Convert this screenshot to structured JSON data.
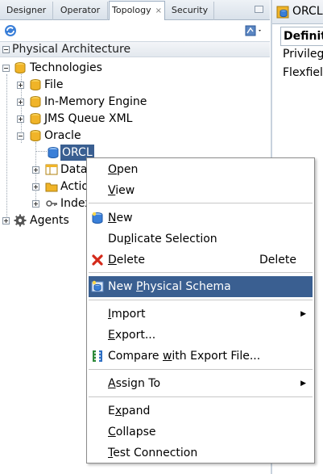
{
  "tabs": [
    {
      "label": "Designer"
    },
    {
      "label": "Operator"
    },
    {
      "label": "Topology",
      "close": "×"
    },
    {
      "label": "Security"
    }
  ],
  "section": {
    "title": "Physical Architecture"
  },
  "tree": {
    "technologies": "Technologies",
    "file": "File",
    "in_memory": "In-Memory Engine",
    "jms": "JMS Queue XML",
    "oracle": "Oracle",
    "orcl": "ORCL",
    "data": "Data",
    "actions": "Actio",
    "indexes": "Index",
    "agents": "Agents"
  },
  "right_pane": {
    "title": "ORCL",
    "subtab": "Definiti",
    "fields": [
      "Privilege",
      "Flexfield"
    ]
  },
  "menu": {
    "open": {
      "pre": "",
      "u": "O",
      "post": "pen"
    },
    "view": {
      "pre": "",
      "u": "V",
      "post": "iew"
    },
    "new": {
      "pre": "",
      "u": "N",
      "post": "ew"
    },
    "duplicate": {
      "pre": "Du",
      "u": "p",
      "post": "licate Selection"
    },
    "delete": {
      "pre": "",
      "u": "D",
      "post": "elete",
      "shortcut": "Delete"
    },
    "new_schema": {
      "pre": "New ",
      "u": "P",
      "post": "hysical Schema"
    },
    "import": {
      "pre": "",
      "u": "I",
      "post": "mport"
    },
    "export": {
      "pre": "",
      "u": "E",
      "post": "xport..."
    },
    "compare": {
      "pre": "Compare ",
      "u": "w",
      "post": "ith Export File..."
    },
    "assign": {
      "pre": "",
      "u": "A",
      "post": "ssign To"
    },
    "expand": {
      "pre": "E",
      "u": "x",
      "post": "pand"
    },
    "collapse": {
      "pre": "",
      "u": "C",
      "post": "ollapse"
    },
    "test": {
      "pre": "",
      "u": "T",
      "post": "est Connection"
    }
  },
  "colors": {
    "selection": "#3a5f91",
    "folder": "#f0b428",
    "db": "#3a7fd8"
  },
  "icons": [
    "refresh-icon",
    "action-menu-icon",
    "database-icon",
    "folder-icon",
    "gear-icon",
    "datastore-icon",
    "index-icon",
    "delete-icon",
    "compare-icon"
  ]
}
